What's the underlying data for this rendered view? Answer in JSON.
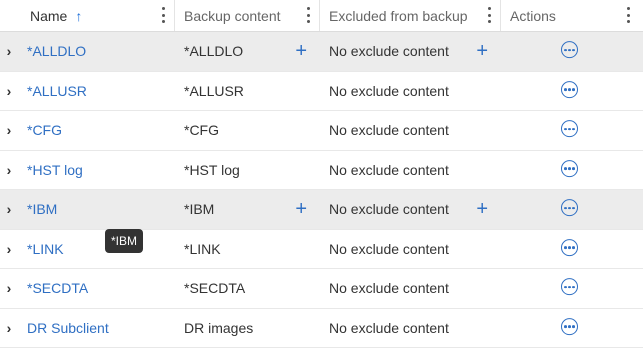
{
  "table": {
    "columns": {
      "name": "Name",
      "backup": "Backup content",
      "excluded": "Excluded from backup",
      "actions": "Actions"
    },
    "sort_indicator": "↑",
    "rows": [
      {
        "name": "*ALLDLO",
        "backup": "*ALLDLO",
        "excluded": "No exclude content",
        "highlighted": true
      },
      {
        "name": "*ALLUSR",
        "backup": "*ALLUSR",
        "excluded": "No exclude content",
        "highlighted": false
      },
      {
        "name": "*CFG",
        "backup": "*CFG",
        "excluded": "No exclude content",
        "highlighted": false
      },
      {
        "name": "*HST log",
        "backup": "*HST log",
        "excluded": "No exclude content",
        "highlighted": false
      },
      {
        "name": "*IBM",
        "backup": "*IBM",
        "excluded": "No exclude content",
        "highlighted": true
      },
      {
        "name": "*LINK",
        "backup": "*LINK",
        "excluded": "No exclude content",
        "highlighted": false
      },
      {
        "name": "*SECDTA",
        "backup": "*SECDTA",
        "excluded": "No exclude content",
        "highlighted": false
      },
      {
        "name": "DR Subclient",
        "backup": "DR images",
        "excluded": "No exclude content",
        "highlighted": false
      }
    ]
  },
  "tooltip": {
    "text": "*IBM"
  },
  "icons": {
    "expand": "chevron-right-icon",
    "add": "plus-icon",
    "actions": "more-horizontal-circle-icon",
    "column_menu": "kebab-vertical-icon",
    "sort": "arrow-up-icon"
  },
  "colors": {
    "link": "#2f6fc3",
    "highlight_row": "#ececec",
    "tooltip_bg": "#333333"
  }
}
